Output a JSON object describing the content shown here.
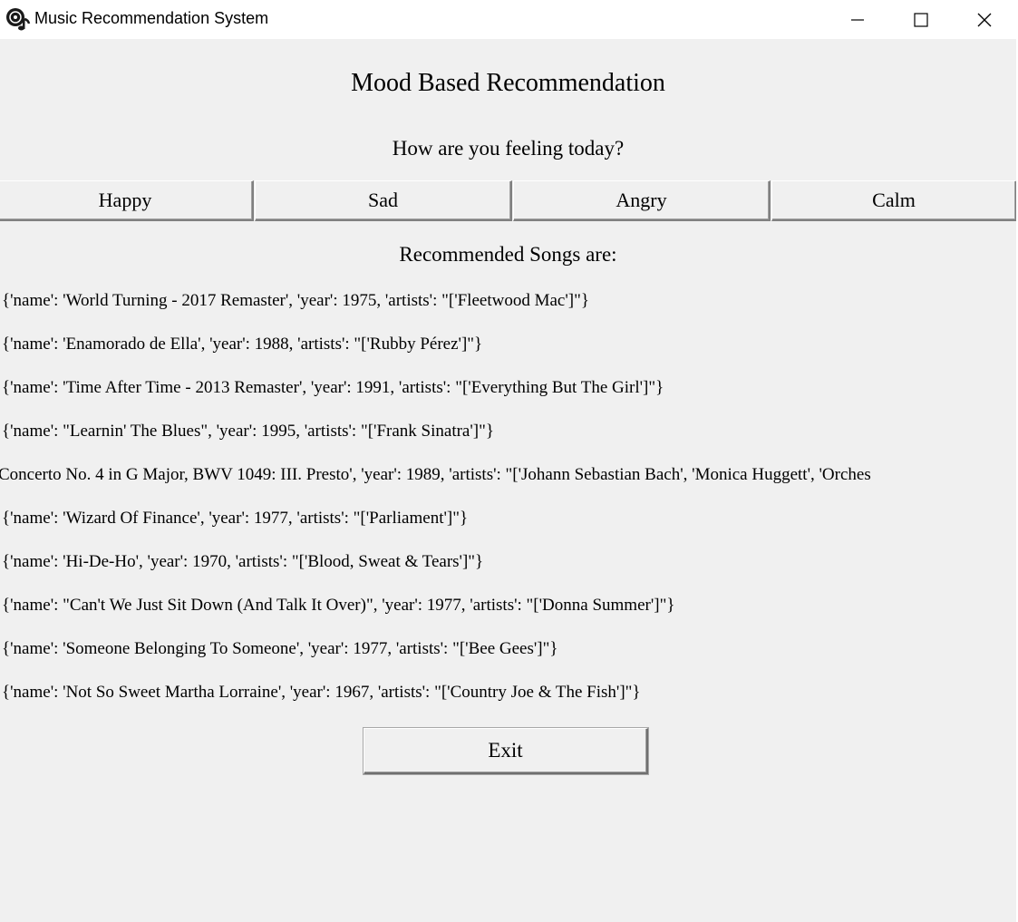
{
  "window": {
    "title": "Music Recommendation System",
    "icon": "music-disc-icon",
    "controls": [
      "minimize-icon",
      "maximize-icon",
      "close-icon"
    ]
  },
  "main": {
    "heading": "Mood Based Recommendation",
    "question": "How are you feeling today?",
    "moods": [
      "Happy",
      "Sad",
      "Angry",
      "Calm"
    ],
    "recommended_title": "Recommended Songs are:",
    "songs": [
      "{'name': 'World Turning - 2017 Remaster', 'year': 1975, 'artists': \"['Fleetwood Mac']\"}",
      "{'name': 'Enamorado de Ella', 'year': 1988, 'artists': \"['Rubby Pérez']\"}",
      "{'name': 'Time After Time - 2013 Remaster', 'year': 1991, 'artists': \"['Everything But The Girl']\"}",
      "{'name': \"Learnin' The Blues\", 'year': 1995, 'artists': \"['Frank Sinatra']\"}",
      "Concerto No. 4 in G Major, BWV 1049: III. Presto', 'year': 1989, 'artists': \"['Johann Sebastian Bach', 'Monica Huggett', 'Orches",
      "{'name': 'Wizard Of Finance', 'year': 1977, 'artists': \"['Parliament']\"}",
      "{'name': 'Hi-De-Ho', 'year': 1970, 'artists': \"['Blood, Sweat & Tears']\"}",
      "{'name': \"Can't We Just Sit Down (And Talk It Over)\", 'year': 1977, 'artists': \"['Donna Summer']\"}",
      "{'name': 'Someone Belonging To Someone', 'year': 1977, 'artists': \"['Bee Gees']\"}",
      "{'name': 'Not So Sweet Martha Lorraine', 'year': 1967, 'artists': \"['Country Joe & The Fish']\"}"
    ],
    "exit_label": "Exit"
  }
}
